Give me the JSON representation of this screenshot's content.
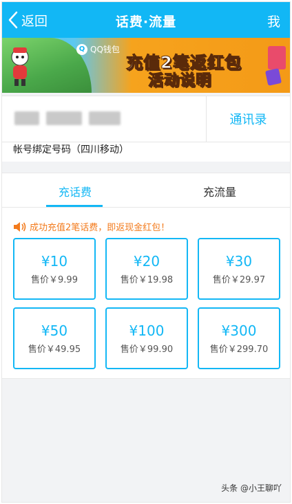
{
  "nav": {
    "back_label": "返回",
    "title": "话费·流量",
    "me_label": "我"
  },
  "banner": {
    "wallet_label": "QQ钱包",
    "headline": "充值2笔返红包",
    "subline": "活动说明"
  },
  "phone": {
    "contacts_label": "通讯录",
    "binding_text": "帐号绑定号码（四川移动）"
  },
  "tabs": [
    {
      "label": "充话费",
      "active": true
    },
    {
      "label": "充流量",
      "active": false
    }
  ],
  "notice": "成功充值2笔话费，即返现金红包！",
  "products": [
    {
      "face": "¥10",
      "price": "售价￥9.99"
    },
    {
      "face": "¥20",
      "price": "售价￥19.98"
    },
    {
      "face": "¥30",
      "price": "售价￥29.97"
    },
    {
      "face": "¥50",
      "price": "售价￥49.95"
    },
    {
      "face": "¥100",
      "price": "售价￥99.90"
    },
    {
      "face": "¥300",
      "price": "售价￥299.70"
    }
  ],
  "watermark": "头条 @小王聊吖",
  "colors": {
    "accent": "#12b7f5",
    "notice": "#f37b1d",
    "background": "#f2f3f5"
  }
}
